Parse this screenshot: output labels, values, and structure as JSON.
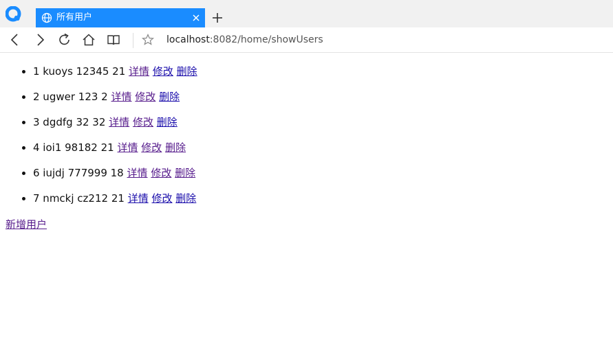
{
  "browser": {
    "tab": {
      "title": "所有用户",
      "icon": "globe-icon"
    },
    "address": {
      "host": "localhost",
      "rest": ":8082/home/showUsers"
    },
    "colors": {
      "tab_active": "#1a8cff",
      "link": "#1a0dab",
      "link_visited": "#551a8b"
    }
  },
  "users": [
    {
      "text": "1 kuoys 12345 21",
      "detail": "详情",
      "edit": "修改",
      "delete": "删除"
    },
    {
      "text": "2 ugwer 123 2",
      "detail": "详情",
      "edit": "修改",
      "delete": "删除"
    },
    {
      "text": "3 dgdfg 32 32",
      "detail": "详情",
      "edit": "修改",
      "delete": "删除"
    },
    {
      "text": "4 ioi1 98182 21",
      "detail": "详情",
      "edit": "修改",
      "delete": "删除"
    },
    {
      "text": "6 iujdj 777999 18",
      "detail": "详情",
      "edit": "修改",
      "delete": "删除"
    },
    {
      "text": "7 nmckj cz212 21",
      "detail": "详情",
      "edit": "修改",
      "delete": "删除"
    }
  ],
  "add_user_label": "新增用户"
}
